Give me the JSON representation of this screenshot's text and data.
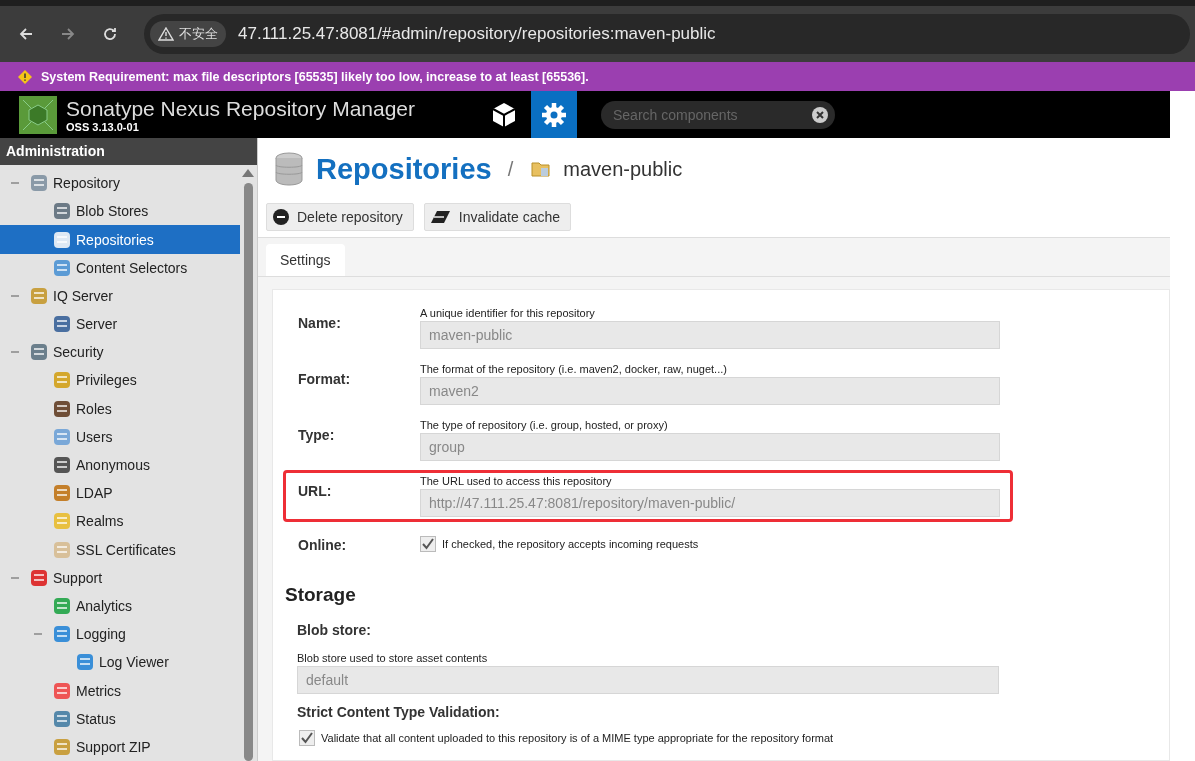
{
  "browser": {
    "security_label": "不安全",
    "url": "47.111.25.47:8081/#admin/repository/repositories:maven-public"
  },
  "banner": {
    "text": "System Requirement: max file descriptors [65535] likely too low, increase to at least [65536]."
  },
  "header": {
    "title": "Sonatype Nexus Repository Manager",
    "version": "OSS 3.13.0-01",
    "search": {
      "placeholder": "Search components"
    }
  },
  "sidebar": {
    "title": "Administration",
    "items": [
      {
        "label": "Repository",
        "expanded": true,
        "selected": false,
        "children": [
          {
            "label": "Blob Stores",
            "selected": false
          },
          {
            "label": "Repositories",
            "selected": true
          },
          {
            "label": "Content Selectors",
            "selected": false
          }
        ]
      },
      {
        "label": "IQ Server",
        "expanded": true,
        "selected": false,
        "children": [
          {
            "label": "Server",
            "selected": false
          }
        ]
      },
      {
        "label": "Security",
        "expanded": true,
        "selected": false,
        "children": [
          {
            "label": "Privileges",
            "selected": false
          },
          {
            "label": "Roles",
            "selected": false
          },
          {
            "label": "Users",
            "selected": false
          },
          {
            "label": "Anonymous",
            "selected": false
          },
          {
            "label": "LDAP",
            "selected": false
          },
          {
            "label": "Realms",
            "selected": false
          },
          {
            "label": "SSL Certificates",
            "selected": false
          }
        ]
      },
      {
        "label": "Support",
        "expanded": true,
        "selected": false,
        "children": [
          {
            "label": "Analytics",
            "selected": false
          },
          {
            "label": "Logging",
            "expanded": true,
            "selected": false,
            "children": [
              {
                "label": "Log Viewer",
                "selected": false
              }
            ]
          },
          {
            "label": "Metrics",
            "selected": false
          },
          {
            "label": "Status",
            "selected": false
          },
          {
            "label": "Support ZIP",
            "selected": false
          }
        ]
      }
    ]
  },
  "page": {
    "title": "Repositories",
    "separator": "/",
    "subtitle": "maven-public",
    "buttons": [
      "Delete repository",
      "Invalidate cache"
    ],
    "tabs": [
      {
        "label": "Settings",
        "selected": true
      }
    ],
    "fields": [
      {
        "kind": "text",
        "label": "Name:",
        "help": "A unique identifier for this repository",
        "value": "maven-public",
        "highlighted": false
      },
      {
        "kind": "text",
        "label": "Format:",
        "help": "The format of the repository (i.e. maven2, docker, raw, nuget...)",
        "value": "maven2",
        "highlighted": false
      },
      {
        "kind": "text",
        "label": "Type:",
        "help": "The type of repository (i.e. group, hosted, or proxy)",
        "value": "group",
        "highlighted": false
      },
      {
        "kind": "text",
        "label": "URL:",
        "help": "The URL used to access this repository",
        "value": "http://47.111.25.47:8081/repository/maven-public/",
        "highlighted": true
      },
      {
        "kind": "checkbox",
        "label": "Online:",
        "help": "If checked, the repository accepts incoming requests",
        "checked": true
      }
    ],
    "storage": {
      "title": "Storage",
      "blob_label": "Blob store:",
      "blob_help": "Blob store used to store asset contents",
      "blob_value": "default",
      "strict_label": "Strict Content Type Validation:",
      "strict_help": "Validate that all content uploaded to this repository is of a MIME type appropriate for the repository format",
      "strict_checked": true
    }
  }
}
